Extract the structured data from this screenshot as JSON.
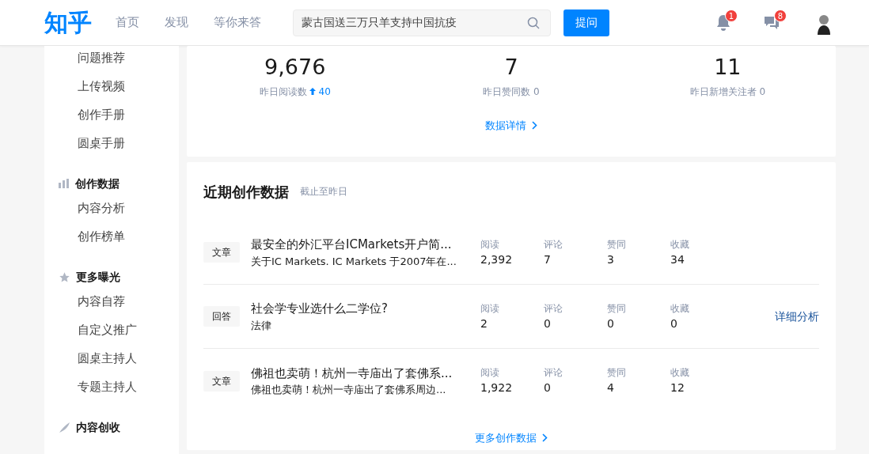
{
  "header": {
    "logo": "知乎",
    "nav": [
      {
        "label": "首页",
        "selected": false
      },
      {
        "label": "发现",
        "selected": false
      },
      {
        "label": "等你来答",
        "selected": false
      }
    ],
    "search": {
      "value": "蒙古国送三万只羊支持中国抗疫"
    },
    "ask_button": "提问",
    "notifications": "1",
    "messages": "8"
  },
  "sidebar": {
    "groups": [
      {
        "items": [
          "问题推荐",
          "上传视频",
          "创作手册",
          "圆桌手册"
        ]
      },
      {
        "title": "创作数据",
        "items": [
          "内容分析",
          "创作榜单"
        ]
      },
      {
        "title": "更多曝光",
        "items": [
          "内容自荐",
          "自定义推广",
          "圆桌主持人",
          "专题主持人"
        ]
      },
      {
        "title": "内容创收"
      }
    ]
  },
  "stats": {
    "items": [
      {
        "value": "9,676",
        "sub": "昨日阅读数",
        "delta": "40"
      },
      {
        "value": "7",
        "sub": "昨日赞同数 0"
      },
      {
        "value": "11",
        "sub": "昨日新增关注者 0"
      }
    ],
    "link": "数据详情"
  },
  "recent": {
    "title": "近期创作数据",
    "note": "截止至昨日",
    "rows": [
      {
        "tag": "文章",
        "title": "最安全的外汇平台ICMarkets开户简...",
        "excerpt": "关于IC Markets. IC Markets 于2007年在...",
        "metrics": [
          {
            "label": "阅读",
            "value": "2,392"
          },
          {
            "label": "评论",
            "value": "7"
          },
          {
            "label": "赞同",
            "value": "3"
          },
          {
            "label": "收藏",
            "value": "34"
          }
        ]
      },
      {
        "tag": "回答",
        "title": "社会学专业选什么二学位?",
        "excerpt": "法律",
        "metrics": [
          {
            "label": "阅读",
            "value": "2"
          },
          {
            "label": "评论",
            "value": "0"
          },
          {
            "label": "赞同",
            "value": "0"
          },
          {
            "label": "收藏",
            "value": "0"
          }
        ],
        "action": "详细分析"
      },
      {
        "tag": "文章",
        "title": "佛祖也卖萌！杭州一寺庙出了套佛系...",
        "excerpt": "佛祖也卖萌！杭州一寺庙出了套佛系周边...",
        "metrics": [
          {
            "label": "阅读",
            "value": "1,922"
          },
          {
            "label": "评论",
            "value": "0"
          },
          {
            "label": "赞同",
            "value": "4"
          },
          {
            "label": "收藏",
            "value": "12"
          }
        ]
      }
    ],
    "more": "更多创作数据"
  }
}
